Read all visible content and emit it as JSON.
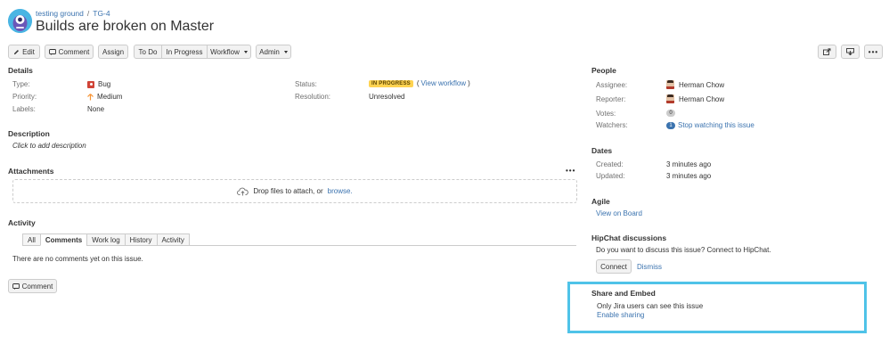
{
  "header": {
    "project": "testing ground",
    "separator": "/",
    "issue_key": "TG-4",
    "summary": "Builds are broken on Master"
  },
  "toolbar": {
    "edit": "Edit",
    "comment": "Comment",
    "assign": "Assign",
    "todo": "To Do",
    "in_progress": "In Progress",
    "workflow": "Workflow",
    "admin": "Admin"
  },
  "details": {
    "title": "Details",
    "type_label": "Type:",
    "type_value": "Bug",
    "priority_label": "Priority:",
    "priority_value": "Medium",
    "labels_label": "Labels:",
    "labels_value": "None",
    "status_label": "Status:",
    "status_value": "IN PROGRESS",
    "status_link_open": "(",
    "status_link": "View workflow",
    "status_link_close": ")",
    "resolution_label": "Resolution:",
    "resolution_value": "Unresolved"
  },
  "description": {
    "title": "Description",
    "placeholder": "Click to add description"
  },
  "attachments": {
    "title": "Attachments",
    "menu": "•••",
    "drop_text": "Drop files to attach, or",
    "browse": "browse."
  },
  "activity": {
    "title": "Activity",
    "tabs": [
      "All",
      "Comments",
      "Work log",
      "History",
      "Activity"
    ],
    "active_tab": "Comments",
    "empty": "There are no comments yet on this issue.",
    "comment_button": "Comment"
  },
  "people": {
    "title": "People",
    "assignee_label": "Assignee:",
    "assignee": "Herman Chow",
    "reporter_label": "Reporter:",
    "reporter": "Herman Chow",
    "votes_label": "Votes:",
    "votes": "0",
    "watchers_label": "Watchers:",
    "watchers": "1",
    "stop_watching": "Stop watching this issue"
  },
  "dates": {
    "title": "Dates",
    "created_label": "Created:",
    "created": "3 minutes ago",
    "updated_label": "Updated:",
    "updated": "3 minutes ago"
  },
  "agile": {
    "title": "Agile",
    "link": "View on Board"
  },
  "hipchat": {
    "title": "HipChat discussions",
    "text": "Do you want to discuss this issue? Connect to HipChat.",
    "connect": "Connect",
    "dismiss": "Dismiss"
  },
  "share": {
    "title": "Share and Embed",
    "text": "Only Jira users can see this issue",
    "link": "Enable sharing"
  },
  "colors": {
    "link": "#3b73af",
    "status_lozenge": "#ffd351",
    "highlight": "#4fc3e8",
    "bug": "#d04437",
    "priority": "#f79232"
  },
  "icons": [
    "project-avatar-icon",
    "pencil-icon",
    "comment-icon",
    "export-icon",
    "share-icon",
    "more-icon",
    "bug-icon",
    "priority-medium-icon",
    "cloud-upload-icon",
    "user-avatar-icon"
  ]
}
